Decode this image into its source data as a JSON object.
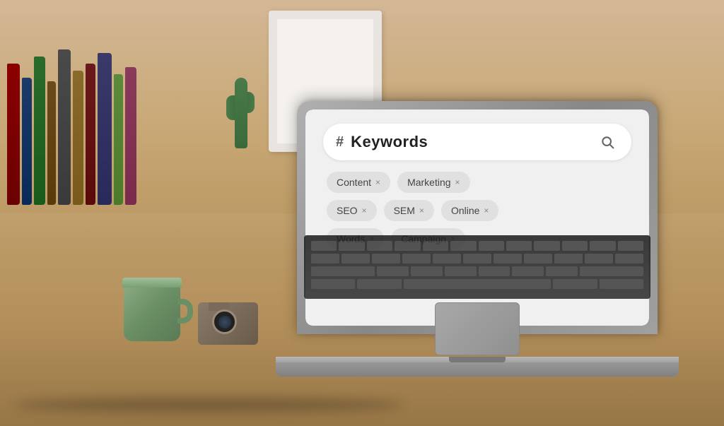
{
  "scene": {
    "title": "Keywords Search UI on Laptop",
    "background": {
      "wall_color": "#ddd8d2",
      "desk_color": "#c8a876"
    }
  },
  "laptop": {
    "screen": {
      "search_bar": {
        "hash_symbol": "#",
        "placeholder": "Keywords",
        "search_icon": "🔍"
      },
      "tags": [
        {
          "label": "Content",
          "has_x": true
        },
        {
          "label": "Marketing",
          "has_x": true
        },
        {
          "label": "SEO",
          "has_x": true
        },
        {
          "label": "SEM",
          "has_x": true
        },
        {
          "label": "Online",
          "has_x": true
        },
        {
          "label": "Words",
          "has_x": true
        },
        {
          "label": "Campaign",
          "has_x": true
        }
      ],
      "tags_rows": [
        [
          "Content",
          "Marketing"
        ],
        [
          "SEO",
          "SEM",
          "Online"
        ],
        [
          "Words",
          "Campaign"
        ]
      ]
    }
  },
  "icons": {
    "search": "🔍",
    "close": "×",
    "hash": "#"
  }
}
